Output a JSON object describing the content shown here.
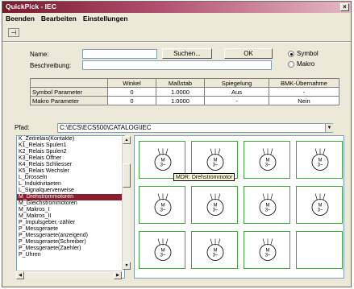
{
  "window": {
    "title": "QuickPick - IEC",
    "close_glyph": "×"
  },
  "menu": [
    "Beenden",
    "Bearbeiten",
    "Einstellungen"
  ],
  "toolbar": {
    "pin_icon": "pin-icon",
    "pin_glyph": "⊣"
  },
  "form": {
    "name_label": "Name:",
    "name_value": "",
    "desc_label": "Beschreibung:",
    "desc_value": "",
    "search_button": "Suchen...",
    "ok_button": "OK",
    "radio_symbol": "Symbol",
    "radio_makro": "Makro",
    "selected_radio": "Symbol"
  },
  "params": {
    "headers": [
      "",
      "Winkel",
      "Maßstab",
      "Spiegelung",
      "BMK-Übernahme"
    ],
    "rows": [
      [
        "Symbol Parameter",
        "0",
        "1.0000",
        "Aus",
        "-"
      ],
      [
        "Makro Parameter",
        "0",
        "1.0000",
        "-",
        "Nein"
      ]
    ]
  },
  "path": {
    "label": "Pfad:",
    "value": "C:\\ECS\\ECS500\\CATALOG\\IEC"
  },
  "list": {
    "items": [
      "K_Zeitrelais(Kontakte)",
      "K1_Relais Spulen1",
      "K2_Relais Spulen2",
      "K3_Relais Öffner",
      "K4_Relais Schliesser",
      "K5_Relais Wechsler",
      "L_Drosseln",
      "L_Induktivitaeten",
      "L_Signalquerverweise",
      "M_Drehstrommotoren",
      "M_Gleichstrommotoren",
      "M_Makros_I",
      "M_Makros_II",
      "P_Impulsgeber,-zähler",
      "P_Messgeraete",
      "P_Messgeraete(anzeigend)",
      "P_Messgeraete(Schreiber)",
      "P_Messgeraete(Zaehler)",
      "P_Uhren"
    ],
    "selected_index": 9
  },
  "grid": {
    "tooltip": "MDR: Drehstrommotor",
    "symbols": [
      {
        "label": "M\n3~",
        "icon": "motor-symbol-icon"
      },
      {
        "label": "M\n3~",
        "icon": "motor-symbol-icon"
      },
      {
        "label": "M\n3~",
        "icon": "motor-symbol-icon"
      },
      {
        "label": "M\n3~",
        "icon": "motor-symbol-icon"
      },
      {
        "label": "M\n3~",
        "icon": "motor-symbol-icon"
      },
      {
        "label": "M\n3~",
        "icon": "motor-symbol-icon"
      },
      {
        "label": "M\n3~",
        "icon": "motor-symbol-icon"
      },
      {
        "label": "M\n3~",
        "icon": "motor-symbol-icon"
      },
      {
        "label": "M\n3~",
        "icon": "motor-symbol-icon"
      },
      {
        "label": "M\n3~",
        "icon": "motor-symbol-icon"
      },
      {
        "label": "M\n3~",
        "icon": "motor-symbol-icon"
      },
      {
        "label": "",
        "icon": "empty-cell"
      }
    ]
  }
}
